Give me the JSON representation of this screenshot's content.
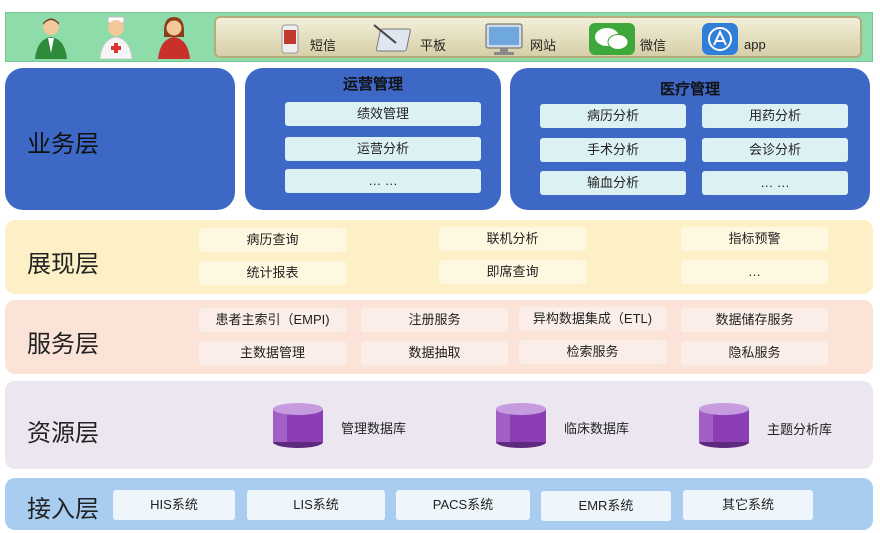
{
  "channels": [
    {
      "icon": "phone-icon",
      "label": "短信"
    },
    {
      "icon": "tablet-icon",
      "label": "平板"
    },
    {
      "icon": "monitor-icon",
      "label": "网站"
    },
    {
      "icon": "wechat-icon",
      "label": "微信"
    },
    {
      "icon": "app-icon",
      "label": "app"
    }
  ],
  "users": [
    "male-user-icon",
    "nurse-user-icon",
    "female-user-icon"
  ],
  "business_layer": {
    "title": "业务层",
    "operations": {
      "title": "运营管理",
      "items": [
        "绩效管理",
        "运营分析",
        "… …"
      ]
    },
    "medical": {
      "title": "医疗管理",
      "items": [
        "病历分析",
        "用药分析",
        "手术分析",
        "会诊分析",
        "输血分析",
        "… …"
      ]
    }
  },
  "presentation_layer": {
    "title": "展现层",
    "items": [
      "病历查询",
      "联机分析",
      "指标预警",
      "统计报表",
      "即席查询",
      "…"
    ]
  },
  "service_layer": {
    "title": "服务层",
    "items": [
      "患者主索引（EMPI)",
      "注册服务",
      "异构数据集成（ETL)",
      "数据储存服务",
      "主数据管理",
      "数据抽取",
      "检索服务",
      "隐私服务"
    ]
  },
  "resource_layer": {
    "title": "资源层",
    "databases": [
      "管理数据库",
      "临床数据库",
      "主题分析库"
    ]
  },
  "access_layer": {
    "title": "接入层",
    "systems": [
      "HIS系统",
      "LIS系统",
      "PACS系统",
      "EMR系统",
      "其它系统"
    ]
  },
  "colors": {
    "top_strip": "#8fdcab",
    "business": "#3d68c6",
    "presentation": "#fdf0c6",
    "service": "#fbe3d8",
    "resource": "#ebe6ef",
    "access": "#a9cdf0",
    "database": "#8c3fb5"
  }
}
